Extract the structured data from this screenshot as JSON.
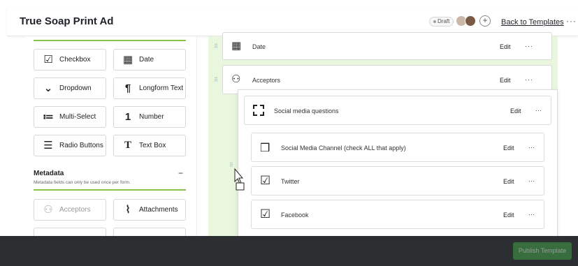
{
  "header": {
    "title": "True Soap Print Ad",
    "status": "Draft",
    "add_symbol": "+",
    "back_link": "Back to Templates",
    "more": "···"
  },
  "left_panel": {
    "fields": [
      {
        "label": "Checkbox",
        "icon": "checkbox-icon",
        "glyph": "☑"
      },
      {
        "label": "Date",
        "icon": "calendar-icon",
        "glyph": "▦"
      },
      {
        "label": "Dropdown",
        "icon": "chevron-down-icon",
        "glyph": "⌄"
      },
      {
        "label": "Longform Text",
        "icon": "paragraph-icon",
        "glyph": "¶"
      },
      {
        "label": "Multi-Select",
        "icon": "multi-select-icon",
        "glyph": "≔"
      },
      {
        "label": "Number",
        "icon": "number-icon",
        "glyph": "1"
      },
      {
        "label": "Radio Buttons",
        "icon": "list-icon",
        "glyph": "☰"
      },
      {
        "label": "Text Box",
        "icon": "text-icon",
        "glyph": "T"
      }
    ],
    "metadata": {
      "title": "Metadata",
      "collapse": "−",
      "subtitle": "Metadata fields can only be used once per form.",
      "fields": [
        {
          "label": "Acceptors",
          "icon": "person-icon",
          "glyph": "⚇",
          "disabled": true
        },
        {
          "label": "Attachments",
          "icon": "paperclip-icon",
          "glyph": "⌇",
          "disabled": false
        }
      ]
    }
  },
  "canvas": {
    "rows": [
      {
        "label": "Date",
        "edit": "Edit",
        "more": "···",
        "icon": "calendar-icon",
        "glyph": "▦"
      },
      {
        "label": "Acceptors",
        "edit": "Edit",
        "more": "···",
        "icon": "person-icon",
        "glyph": "⚇"
      }
    ],
    "dragging_group": {
      "label": "Social media questions",
      "edit": "Edit",
      "more": "···",
      "icon": "dashed-box-icon",
      "children": [
        {
          "label": "Social Media Channel (check ALL that apply)",
          "edit": "Edit",
          "more": "···",
          "icon": "book-icon",
          "glyph": "❒"
        },
        {
          "label": "Twitter",
          "edit": "Edit",
          "more": "···",
          "icon": "checkbox-icon",
          "glyph": "☑"
        },
        {
          "label": "Facebook",
          "edit": "Edit",
          "more": "···",
          "icon": "checkbox-icon",
          "glyph": "☑"
        }
      ]
    }
  },
  "footer": {
    "publish": "Publish Template"
  },
  "colors": {
    "accent": "#8bc34a",
    "canvas_bg": "#e8f7de",
    "footer_bg": "#2b2f31",
    "publish": "#43a047"
  }
}
